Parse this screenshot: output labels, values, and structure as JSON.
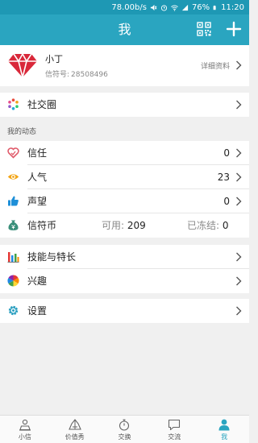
{
  "status_bar": {
    "speed": "78.00b/s",
    "battery": "76%",
    "time": "11:20"
  },
  "app_bar": {
    "title": "我"
  },
  "profile": {
    "name": "小丁",
    "id_label": "信符号:",
    "id_value": "28508496",
    "detail_link": "详细资料"
  },
  "social": {
    "label": "社交圈"
  },
  "activity": {
    "section_title": "我的动态",
    "items": [
      {
        "label": "信任",
        "value": "0"
      },
      {
        "label": "人气",
        "value": "23"
      },
      {
        "label": "声望",
        "value": "0"
      }
    ],
    "coin": {
      "label": "信符币",
      "available_label": "可用:",
      "available_value": "209",
      "frozen_label": "已冻结:",
      "frozen_value": "0"
    }
  },
  "skills": {
    "label": "技能与特长"
  },
  "interests": {
    "label": "兴趣"
  },
  "settings": {
    "label": "设置"
  },
  "tabs": [
    {
      "label": "小信"
    },
    {
      "label": "价值秀"
    },
    {
      "label": "交换"
    },
    {
      "label": "交流"
    },
    {
      "label": "我"
    }
  ],
  "colors": {
    "header": "#2aa5c0",
    "status_bar": "#1e98b4",
    "active_tab": "#2aa5c0"
  }
}
